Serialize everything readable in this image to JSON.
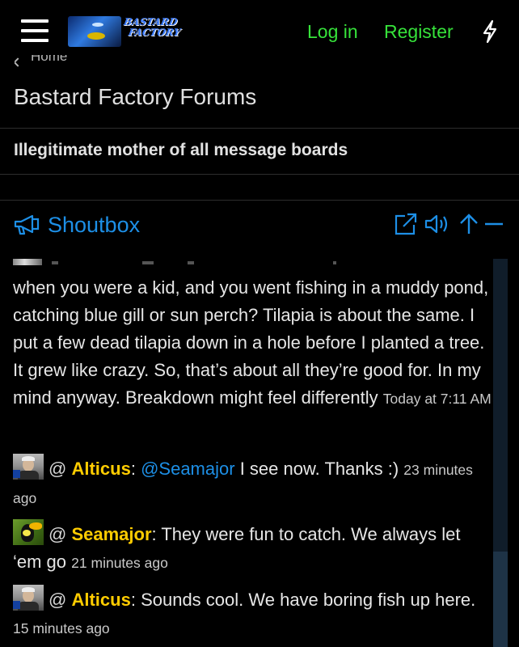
{
  "header": {
    "logo_text_line1": "BASTARD",
    "logo_text_line2": "FACTORY",
    "login_label": "Log in",
    "register_label": "Register"
  },
  "breadcrumb": {
    "label": "Home"
  },
  "site": {
    "title": "Bastard Factory Forums",
    "tagline": "Illegitimate mother of all message boards"
  },
  "shoutbox": {
    "title": "Shoutbox",
    "messages": [
      {
        "text": "when you were a kid, and you went fishing in a muddy pond, catching blue gill or sun perch? Tilapia is about the same. I put a few dead tilapia down in a hole before I planted a tree. It grew like crazy. So, that’s about all they’re good for. In my mind anyway. Breakdown might feel differently",
        "time": "Today at 7:11 AM"
      },
      {
        "at": "@",
        "user": "Alticus",
        "sep": ":",
        "mention": "@Seamajor",
        "text": " I see now. Thanks :)",
        "time": "23 minutes ago"
      },
      {
        "at": "@",
        "user": "Seamajor",
        "sep": ":",
        "text": " They were fun to catch. We always let ‘em go",
        "time": "21 minutes ago"
      },
      {
        "at": "@",
        "user": "Alticus",
        "sep": ":",
        "text": " Sounds cool. We have boring fish up here.",
        "time": "15 minutes ago"
      }
    ]
  },
  "colors": {
    "background": "#000000",
    "nav_green": "#36e23a",
    "accent_blue": "#1d8fe6",
    "username_yellow": "#ffcc00"
  },
  "icons": {
    "menu": "hamburger-icon",
    "bolt": "lightning-bolt-icon",
    "shoutbox": "megaphone-icon",
    "popout": "external-link-icon",
    "sound": "speaker-icon",
    "scroll_top": "arrow-up-icon",
    "collapse": "minus-icon"
  }
}
